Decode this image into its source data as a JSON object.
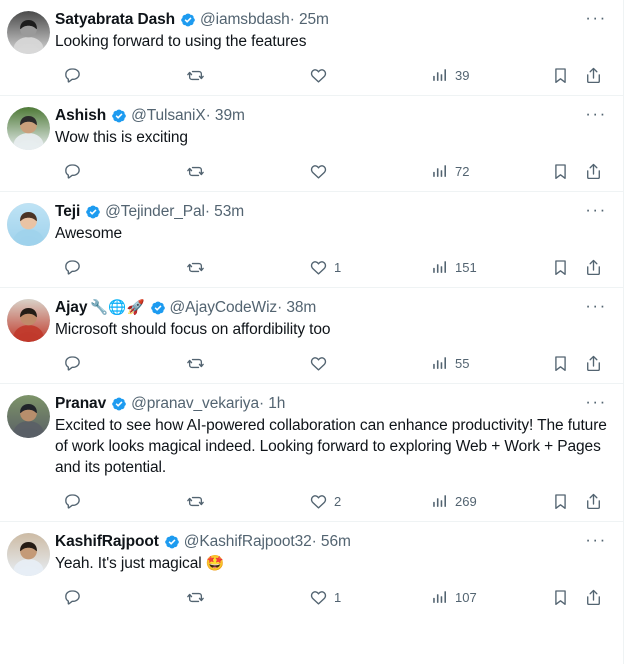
{
  "app": {
    "name": "twitter-feed",
    "icon_names": {
      "reply": "reply-icon",
      "retweet": "retweet-icon",
      "like": "like-icon",
      "views": "views-icon",
      "bookmark": "bookmark-icon",
      "share": "share-icon",
      "more": "more-options-icon",
      "verified": "verified-badge-icon"
    },
    "more_glyph": "···",
    "separator": "·"
  },
  "colors": {
    "text_primary": "#0F1419",
    "text_secondary": "#536471",
    "verified_blue": "#1D9BF0",
    "divider": "#EFF3F4",
    "background": "#FFFFFF"
  },
  "tweets": [
    {
      "display_name": "Satyabrata Dash",
      "name_emoji": "",
      "verified": true,
      "handle": "@iamsbdash",
      "timestamp": "25m",
      "text": "Looking forward to using the features",
      "reply_count": "",
      "retweet_count": "",
      "like_count": "",
      "view_count": "39",
      "avatar": {
        "name": "avatar-satyabrata-dash",
        "description": "black-and-white side portrait of a man",
        "bg": "#4a4a4a",
        "accent": "#d8d8d8",
        "skin": "#9a9a9a",
        "hair": "#1c1c1c"
      }
    },
    {
      "display_name": "Ashish",
      "name_emoji": "",
      "verified": true,
      "handle": "@TulsaniX",
      "timestamp": "39m",
      "text": "Wow this is exciting",
      "reply_count": "",
      "retweet_count": "",
      "like_count": "",
      "view_count": "72",
      "avatar": {
        "name": "avatar-ashish",
        "description": "man standing outdoors on a green lawn",
        "bg": "#4f7a37",
        "accent": "#e8eef0",
        "skin": "#caa07c",
        "hair": "#2b2b2b"
      }
    },
    {
      "display_name": "Teji",
      "name_emoji": "",
      "verified": true,
      "handle": "@Tejinder_Pal",
      "timestamp": "53m",
      "text": "Awesome",
      "reply_count": "",
      "retweet_count": "",
      "like_count": "1",
      "view_count": "151",
      "avatar": {
        "name": "avatar-teji",
        "description": "light blue cartoon avatar of a person in a hoodie",
        "bg": "#bfe3f5",
        "accent": "#9fd2ec",
        "skin": "#e9c3a4",
        "hair": "#4a3426"
      }
    },
    {
      "display_name": "Ajay",
      "name_emoji": "🔧🌐🚀",
      "verified": true,
      "handle": "@AjayCodeWiz",
      "timestamp": "38m",
      "text": "Microsoft should focus on affordibility too",
      "reply_count": "",
      "retweet_count": "",
      "like_count": "",
      "view_count": "55",
      "avatar": {
        "name": "avatar-ajay",
        "description": "portrait of a man in a red shirt on a beige background",
        "bg": "#d9d2c8",
        "accent": "#c0392b",
        "skin": "#c08b6a",
        "hair": "#241c16"
      }
    },
    {
      "display_name": "Pranav",
      "name_emoji": "",
      "verified": true,
      "handle": "@pranav_vekariya",
      "timestamp": "1h",
      "text": "Excited to see how AI-powered collaboration can enhance productivity! The future of work looks magical indeed. Looking forward to exploring Web + Work + Pages and its potential.",
      "reply_count": "",
      "retweet_count": "",
      "like_count": "2",
      "view_count": "269",
      "avatar": {
        "name": "avatar-pranav",
        "description": "man in a grey shirt standing outdoors with back to camera",
        "bg": "#7d9468",
        "accent": "#5a5f66",
        "skin": "#b78e6c",
        "hair": "#20242a"
      }
    },
    {
      "display_name": "KashifRajpoot",
      "name_emoji": "",
      "verified": true,
      "handle": "@KashifRajpoot32",
      "timestamp": "56m",
      "text_before_emoji": "Yeah. It's just magical ",
      "text_emoji": "🤩",
      "text": "Yeah. It's just magical 🤩",
      "reply_count": "",
      "retweet_count": "",
      "like_count": "1",
      "view_count": "107",
      "avatar": {
        "name": "avatar-kashifrajpoot",
        "description": "man in a long white kurta standing indoors",
        "bg": "#cdbba4",
        "accent": "#e7eef5",
        "skin": "#c49a77",
        "hair": "#241b14"
      }
    }
  ]
}
